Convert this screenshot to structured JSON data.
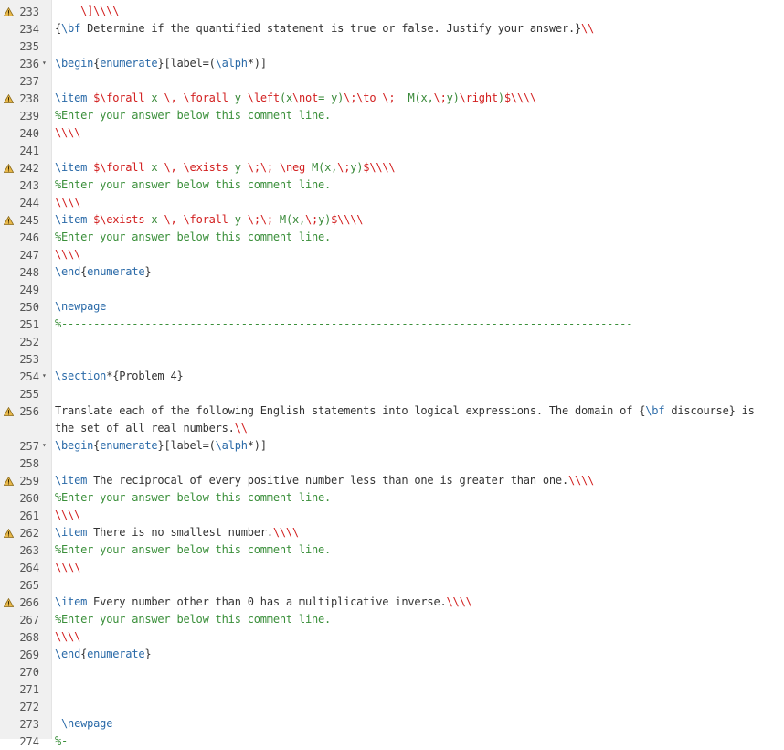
{
  "editor": {
    "colors": {
      "command": "#2a6aa8",
      "bracket_red": "#d21f1f",
      "math_green": "#3a8a3a",
      "comment": "#3a8f3a",
      "text": "#333333",
      "gutter": "#f0f0f0"
    },
    "lines": [
      {
        "n": "233",
        "warn": true,
        "fold": false,
        "segs": [
          {
            "c": "c-text",
            "t": "    "
          },
          {
            "c": "c-br",
            "t": "\\]\\\\\\\\"
          }
        ]
      },
      {
        "n": "234",
        "warn": false,
        "fold": false,
        "segs": [
          {
            "c": "c-text",
            "t": "{"
          },
          {
            "c": "c-cmd",
            "t": "\\bf"
          },
          {
            "c": "c-text",
            "t": " Determine if the quantified statement is true or false. Justify your answer.}"
          },
          {
            "c": "c-br",
            "t": "\\\\"
          }
        ]
      },
      {
        "n": "235",
        "warn": false,
        "fold": false,
        "segs": []
      },
      {
        "n": "236",
        "warn": false,
        "fold": true,
        "segs": [
          {
            "c": "c-cmd",
            "t": "\\begin"
          },
          {
            "c": "c-text",
            "t": "{"
          },
          {
            "c": "c-cmd",
            "t": "enumerate"
          },
          {
            "c": "c-text",
            "t": "}[label=("
          },
          {
            "c": "c-cmd",
            "t": "\\alph"
          },
          {
            "c": "c-text",
            "t": "*)]"
          }
        ]
      },
      {
        "n": "237",
        "warn": false,
        "fold": false,
        "segs": []
      },
      {
        "n": "238",
        "warn": true,
        "fold": false,
        "segs": [
          {
            "c": "c-cmd",
            "t": "\\item"
          },
          {
            "c": "c-text",
            "t": " "
          },
          {
            "c": "c-br",
            "t": "$"
          },
          {
            "c": "c-br",
            "t": "\\forall"
          },
          {
            "c": "c-math",
            "t": " x "
          },
          {
            "c": "c-br",
            "t": "\\,"
          },
          {
            "c": "c-math",
            "t": " "
          },
          {
            "c": "c-br",
            "t": "\\forall"
          },
          {
            "c": "c-math",
            "t": " y "
          },
          {
            "c": "c-br",
            "t": "\\left"
          },
          {
            "c": "c-math",
            "t": "(x"
          },
          {
            "c": "c-br",
            "t": "\\not"
          },
          {
            "c": "c-math",
            "t": "= y)"
          },
          {
            "c": "c-br",
            "t": "\\;\\to"
          },
          {
            "c": "c-math",
            "t": " "
          },
          {
            "c": "c-br",
            "t": "\\;"
          },
          {
            "c": "c-math",
            "t": "  M(x,"
          },
          {
            "c": "c-br",
            "t": "\\;"
          },
          {
            "c": "c-math",
            "t": "y)"
          },
          {
            "c": "c-br",
            "t": "\\right"
          },
          {
            "c": "c-math",
            "t": ")"
          },
          {
            "c": "c-br",
            "t": "$\\\\\\\\"
          }
        ]
      },
      {
        "n": "239",
        "warn": false,
        "fold": false,
        "segs": [
          {
            "c": "c-comm",
            "t": "%Enter your answer below this comment line."
          }
        ]
      },
      {
        "n": "240",
        "warn": false,
        "fold": false,
        "segs": [
          {
            "c": "c-br",
            "t": "\\\\\\\\"
          }
        ]
      },
      {
        "n": "241",
        "warn": false,
        "fold": false,
        "segs": []
      },
      {
        "n": "242",
        "warn": true,
        "fold": false,
        "segs": [
          {
            "c": "c-cmd",
            "t": "\\item"
          },
          {
            "c": "c-text",
            "t": " "
          },
          {
            "c": "c-br",
            "t": "$\\forall"
          },
          {
            "c": "c-math",
            "t": " x "
          },
          {
            "c": "c-br",
            "t": "\\,"
          },
          {
            "c": "c-math",
            "t": " "
          },
          {
            "c": "c-br",
            "t": "\\exists"
          },
          {
            "c": "c-math",
            "t": " y "
          },
          {
            "c": "c-br",
            "t": "\\;\\;"
          },
          {
            "c": "c-math",
            "t": " "
          },
          {
            "c": "c-br",
            "t": "\\neg"
          },
          {
            "c": "c-math",
            "t": " M(x,"
          },
          {
            "c": "c-br",
            "t": "\\;"
          },
          {
            "c": "c-math",
            "t": "y)"
          },
          {
            "c": "c-br",
            "t": "$\\\\\\\\"
          }
        ]
      },
      {
        "n": "243",
        "warn": false,
        "fold": false,
        "segs": [
          {
            "c": "c-comm",
            "t": "%Enter your answer below this comment line."
          }
        ]
      },
      {
        "n": "244",
        "warn": false,
        "fold": false,
        "segs": [
          {
            "c": "c-br",
            "t": "\\\\\\\\"
          }
        ]
      },
      {
        "n": "245",
        "warn": true,
        "fold": false,
        "segs": [
          {
            "c": "c-cmd",
            "t": "\\item"
          },
          {
            "c": "c-text",
            "t": " "
          },
          {
            "c": "c-br",
            "t": "$\\exists"
          },
          {
            "c": "c-math",
            "t": " x "
          },
          {
            "c": "c-br",
            "t": "\\,"
          },
          {
            "c": "c-math",
            "t": " "
          },
          {
            "c": "c-br",
            "t": "\\forall"
          },
          {
            "c": "c-math",
            "t": " y "
          },
          {
            "c": "c-br",
            "t": "\\;\\;"
          },
          {
            "c": "c-math",
            "t": " M(x,"
          },
          {
            "c": "c-br",
            "t": "\\;"
          },
          {
            "c": "c-math",
            "t": "y)"
          },
          {
            "c": "c-br",
            "t": "$\\\\\\\\"
          }
        ]
      },
      {
        "n": "246",
        "warn": false,
        "fold": false,
        "segs": [
          {
            "c": "c-comm",
            "t": "%Enter your answer below this comment line."
          }
        ]
      },
      {
        "n": "247",
        "warn": false,
        "fold": false,
        "segs": [
          {
            "c": "c-br",
            "t": "\\\\\\\\"
          }
        ]
      },
      {
        "n": "248",
        "warn": false,
        "fold": false,
        "segs": [
          {
            "c": "c-cmd",
            "t": "\\end"
          },
          {
            "c": "c-text",
            "t": "{"
          },
          {
            "c": "c-cmd",
            "t": "enumerate"
          },
          {
            "c": "c-text",
            "t": "}"
          }
        ]
      },
      {
        "n": "249",
        "warn": false,
        "fold": false,
        "segs": []
      },
      {
        "n": "250",
        "warn": false,
        "fold": false,
        "segs": [
          {
            "c": "c-cmd",
            "t": "\\newpage"
          }
        ]
      },
      {
        "n": "251",
        "warn": false,
        "fold": false,
        "segs": [
          {
            "c": "c-comm",
            "t": "%-----------------------------------------------------------------------------------------"
          }
        ]
      },
      {
        "n": "252",
        "warn": false,
        "fold": false,
        "segs": []
      },
      {
        "n": "253",
        "warn": false,
        "fold": false,
        "segs": []
      },
      {
        "n": "254",
        "warn": false,
        "fold": true,
        "segs": [
          {
            "c": "c-cmd",
            "t": "\\section"
          },
          {
            "c": "c-text",
            "t": "*{Problem 4}"
          }
        ]
      },
      {
        "n": "255",
        "warn": false,
        "fold": false,
        "segs": []
      },
      {
        "n": "256",
        "warn": true,
        "fold": false,
        "segs": [
          {
            "c": "c-text",
            "t": "Translate each of the following English statements into logical expressions. The domain of {"
          },
          {
            "c": "c-cmd",
            "t": "\\bf"
          },
          {
            "c": "c-text",
            "t": " discourse} is"
          }
        ]
      },
      {
        "n": "",
        "warn": false,
        "fold": false,
        "segs": [
          {
            "c": "c-text",
            "t": "the set of all real numbers."
          },
          {
            "c": "c-br",
            "t": "\\\\"
          }
        ]
      },
      {
        "n": "257",
        "warn": false,
        "fold": true,
        "segs": [
          {
            "c": "c-cmd",
            "t": "\\begin"
          },
          {
            "c": "c-text",
            "t": "{"
          },
          {
            "c": "c-cmd",
            "t": "enumerate"
          },
          {
            "c": "c-text",
            "t": "}[label=("
          },
          {
            "c": "c-cmd",
            "t": "\\alph"
          },
          {
            "c": "c-text",
            "t": "*)]"
          }
        ]
      },
      {
        "n": "258",
        "warn": false,
        "fold": false,
        "segs": []
      },
      {
        "n": "259",
        "warn": true,
        "fold": false,
        "segs": [
          {
            "c": "c-cmd",
            "t": "\\item"
          },
          {
            "c": "c-text",
            "t": " The reciprocal of every positive number less than one is greater than one."
          },
          {
            "c": "c-br",
            "t": "\\\\\\\\"
          }
        ]
      },
      {
        "n": "260",
        "warn": false,
        "fold": false,
        "segs": [
          {
            "c": "c-comm",
            "t": "%Enter your answer below this comment line."
          }
        ]
      },
      {
        "n": "261",
        "warn": false,
        "fold": false,
        "segs": [
          {
            "c": "c-br",
            "t": "\\\\\\\\"
          }
        ]
      },
      {
        "n": "262",
        "warn": true,
        "fold": false,
        "segs": [
          {
            "c": "c-cmd",
            "t": "\\item"
          },
          {
            "c": "c-text",
            "t": " There is no smallest number."
          },
          {
            "c": "c-br",
            "t": "\\\\\\\\"
          }
        ]
      },
      {
        "n": "263",
        "warn": false,
        "fold": false,
        "segs": [
          {
            "c": "c-comm",
            "t": "%Enter your answer below this comment line."
          }
        ]
      },
      {
        "n": "264",
        "warn": false,
        "fold": false,
        "segs": [
          {
            "c": "c-br",
            "t": "\\\\\\\\"
          }
        ]
      },
      {
        "n": "265",
        "warn": false,
        "fold": false,
        "segs": []
      },
      {
        "n": "266",
        "warn": true,
        "fold": false,
        "segs": [
          {
            "c": "c-cmd",
            "t": "\\item"
          },
          {
            "c": "c-text",
            "t": " Every number other than 0 has a multiplicative inverse."
          },
          {
            "c": "c-br",
            "t": "\\\\\\\\"
          }
        ]
      },
      {
        "n": "267",
        "warn": false,
        "fold": false,
        "segs": [
          {
            "c": "c-comm",
            "t": "%Enter your answer below this comment line."
          }
        ]
      },
      {
        "n": "268",
        "warn": false,
        "fold": false,
        "segs": [
          {
            "c": "c-br",
            "t": "\\\\\\\\"
          }
        ]
      },
      {
        "n": "269",
        "warn": false,
        "fold": false,
        "segs": [
          {
            "c": "c-cmd",
            "t": "\\end"
          },
          {
            "c": "c-text",
            "t": "{"
          },
          {
            "c": "c-cmd",
            "t": "enumerate"
          },
          {
            "c": "c-text",
            "t": "}"
          }
        ]
      },
      {
        "n": "270",
        "warn": false,
        "fold": false,
        "segs": []
      },
      {
        "n": "271",
        "warn": false,
        "fold": false,
        "segs": []
      },
      {
        "n": "272",
        "warn": false,
        "fold": false,
        "segs": []
      },
      {
        "n": "273",
        "warn": false,
        "fold": false,
        "segs": [
          {
            "c": "c-text",
            "t": " "
          },
          {
            "c": "c-cmd",
            "t": "\\newpage"
          }
        ]
      },
      {
        "n": "274",
        "warn": false,
        "fold": false,
        "segs": [
          {
            "c": "c-comm",
            "t": "%-"
          }
        ]
      }
    ],
    "warning_icon": "warning-triangle-icon",
    "fold_icon": "fold-arrow-icon",
    "fold_glyph": "▾"
  }
}
